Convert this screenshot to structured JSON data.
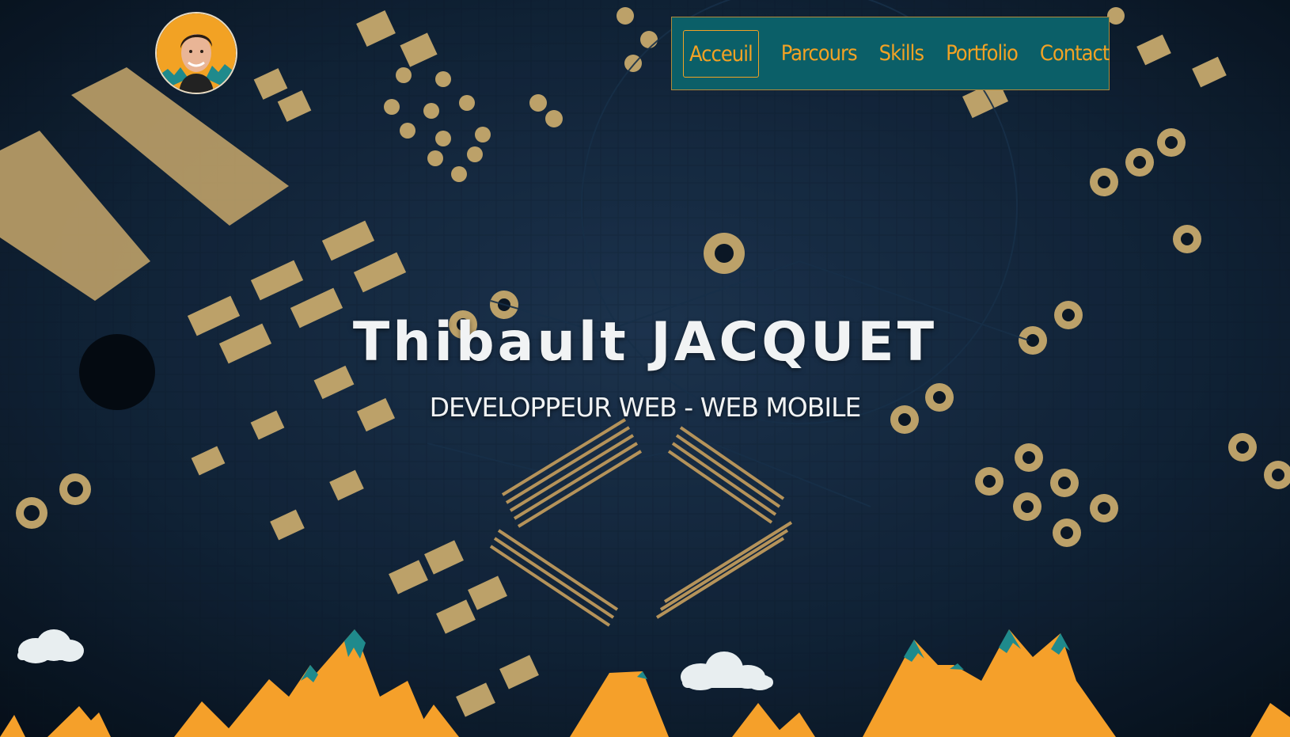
{
  "nav": {
    "items": [
      {
        "label": "Acceuil",
        "active": true
      },
      {
        "label": "Parcours",
        "active": false
      },
      {
        "label": "Skills",
        "active": false
      },
      {
        "label": "Portfolio",
        "active": false
      },
      {
        "label": "Contact",
        "active": false
      }
    ]
  },
  "hero": {
    "name": "Thibault  JACQUET",
    "tagline": "DEVELOPPEUR WEB - WEB MOBILE"
  },
  "icons": {
    "avatar": "profile-photo",
    "clouds": "cloud-icon",
    "mountains": "mountain-illustration"
  },
  "colors": {
    "nav_bg": "#0b5f68",
    "accent": "#f2a224",
    "text": "#f1f3f4",
    "mountain": "#f5a02a",
    "snow": "#1f8a8c",
    "circuit_bg": "#0d2236"
  }
}
